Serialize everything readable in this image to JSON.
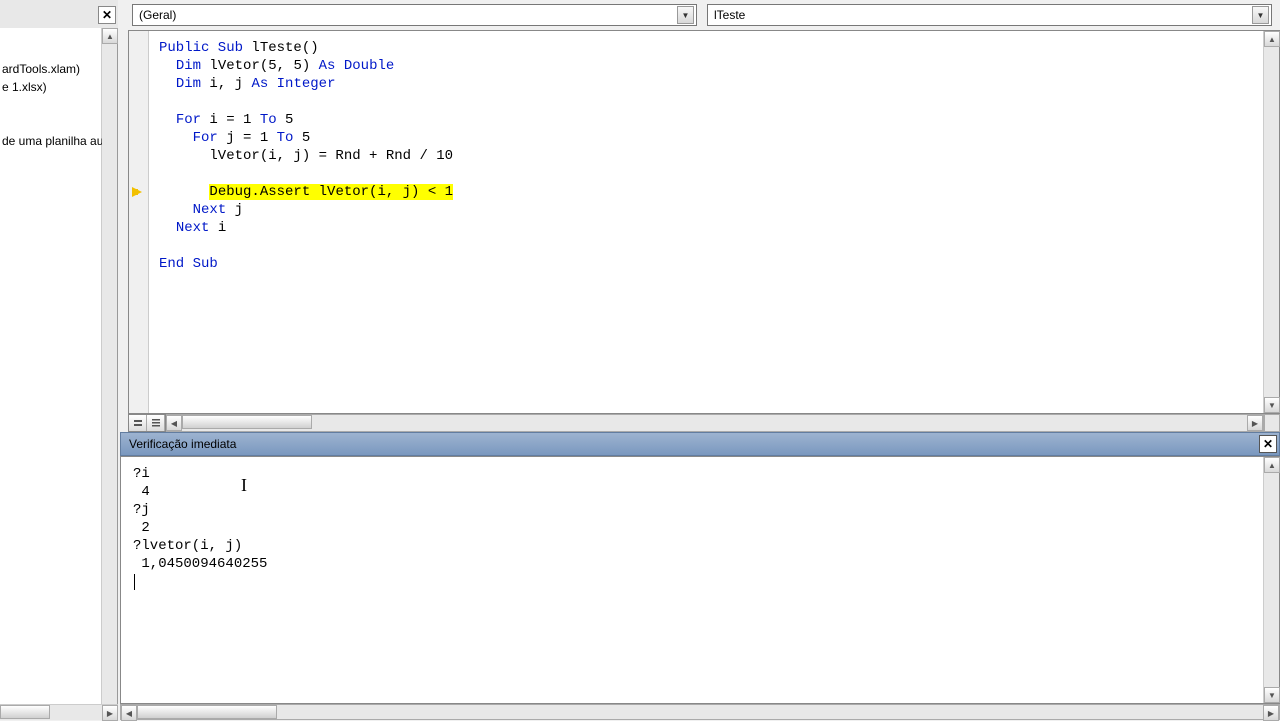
{
  "left_panel": {
    "tree_items": [
      "ardTools.xlam)",
      "e 1.xlsx)",
      "",
      "",
      "de uma planilha aut"
    ]
  },
  "dropdowns": {
    "left": "(Geral)",
    "right": "lTeste"
  },
  "code": {
    "highlighted_line_index": 8,
    "lines": [
      {
        "indent": 0,
        "segments": [
          {
            "t": "Public Sub",
            "k": true
          },
          {
            "t": " lTeste()"
          }
        ]
      },
      {
        "indent": 1,
        "segments": [
          {
            "t": "Dim",
            "k": true
          },
          {
            "t": " lVetor(5, 5) "
          },
          {
            "t": "As Double",
            "k": true
          }
        ]
      },
      {
        "indent": 1,
        "segments": [
          {
            "t": "Dim",
            "k": true
          },
          {
            "t": " i, j "
          },
          {
            "t": "As Integer",
            "k": true
          }
        ]
      },
      {
        "indent": 0,
        "segments": []
      },
      {
        "indent": 1,
        "segments": [
          {
            "t": "For",
            "k": true
          },
          {
            "t": " i = 1 "
          },
          {
            "t": "To",
            "k": true
          },
          {
            "t": " 5"
          }
        ]
      },
      {
        "indent": 2,
        "segments": [
          {
            "t": "For",
            "k": true
          },
          {
            "t": " j = 1 "
          },
          {
            "t": "To",
            "k": true
          },
          {
            "t": " 5"
          }
        ]
      },
      {
        "indent": 3,
        "segments": [
          {
            "t": "lVetor(i, j) = Rnd + Rnd / 10"
          }
        ]
      },
      {
        "indent": 0,
        "segments": []
      },
      {
        "indent": 3,
        "segments": [
          {
            "t": "Debug.Assert lVetor(i, j) < 1"
          }
        ],
        "hl": true
      },
      {
        "indent": 2,
        "segments": [
          {
            "t": "Next",
            "k": true
          },
          {
            "t": " j"
          }
        ]
      },
      {
        "indent": 1,
        "segments": [
          {
            "t": "Next",
            "k": true
          },
          {
            "t": " i"
          }
        ]
      },
      {
        "indent": 0,
        "segments": []
      },
      {
        "indent": 0,
        "segments": [
          {
            "t": "End Sub",
            "k": true
          }
        ]
      }
    ]
  },
  "immediate": {
    "title": "Verificação imediata",
    "lines": [
      "?i",
      " 4 ",
      "?j",
      " 2 ",
      "?lvetor(i, j)",
      " 1,0450094640255 "
    ]
  }
}
